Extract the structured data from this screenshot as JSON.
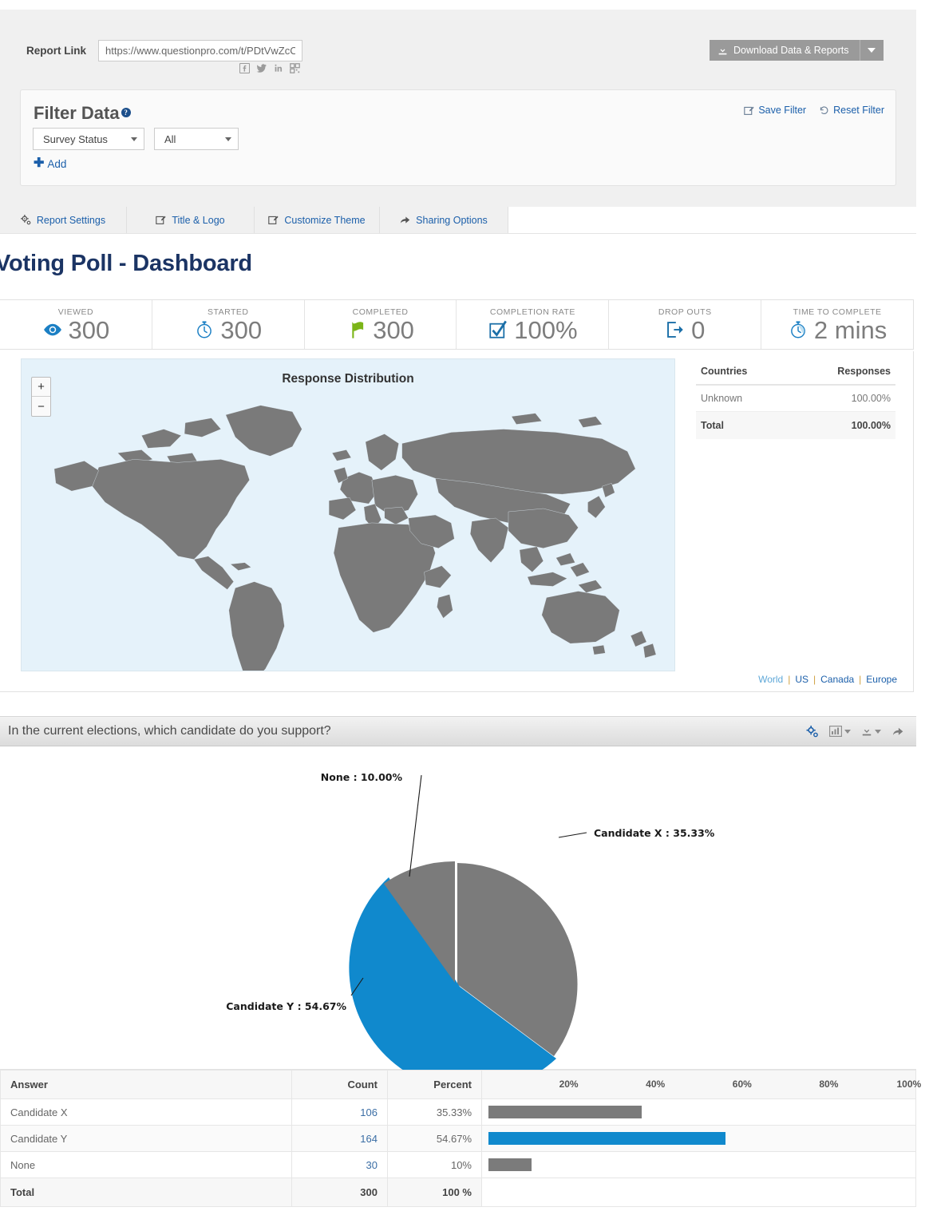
{
  "topbar": {
    "report_link_label": "Report Link",
    "report_link_value": "https://www.questionpro.com/t/PDtVwZcC",
    "download_button": "Download Data & Reports",
    "social": [
      {
        "name": "facebook-icon"
      },
      {
        "name": "twitter-icon"
      },
      {
        "name": "linkedin-icon"
      },
      {
        "name": "qr-code-icon"
      }
    ]
  },
  "filter": {
    "title": "Filter Data",
    "help_char": "?",
    "field_select": "Survey Status",
    "value_select": "All",
    "add_label": "Add",
    "save_label": "Save Filter",
    "reset_label": "Reset Filter"
  },
  "tabs": [
    {
      "label": "Report Settings",
      "icon": "gears-icon"
    },
    {
      "label": "Title & Logo",
      "icon": "edit-icon"
    },
    {
      "label": "Customize Theme",
      "icon": "edit-icon"
    },
    {
      "label": "Sharing Options",
      "icon": "share-icon"
    }
  ],
  "page_title": "Voting Poll - Dashboard",
  "stats": [
    {
      "label": "VIEWED",
      "value": "300",
      "icon": "eye-icon",
      "color": "#1b7fc4"
    },
    {
      "label": "STARTED",
      "value": "300",
      "icon": "stopwatch-icon",
      "color": "#1b7fc4"
    },
    {
      "label": "COMPLETED",
      "value": "300",
      "icon": "flag-icon",
      "color": "#7cb518"
    },
    {
      "label": "COMPLETION RATE",
      "value": "100%",
      "icon": "checkbox-icon",
      "color": "#1b6fa8"
    },
    {
      "label": "DROP OUTS",
      "value": "0",
      "icon": "exit-icon",
      "color": "#1b6fa8"
    },
    {
      "label": "TIME TO COMPLETE",
      "value": "2 mins",
      "icon": "stopwatch-icon",
      "color": "#1b7fc4"
    }
  ],
  "map": {
    "title": "Response Distribution",
    "zoom_in": "+",
    "zoom_out": "−",
    "links": [
      "World",
      "US",
      "Canada",
      "Europe"
    ],
    "separator": "|",
    "table": {
      "headers": [
        "Countries",
        "Responses"
      ],
      "rows": [
        [
          "Unknown",
          "100.00%"
        ]
      ],
      "total": [
        "Total",
        "100.00%"
      ]
    }
  },
  "question": {
    "text": "In the current elections, which candidate do you support?",
    "tools": [
      {
        "name": "settings-gear-icon"
      },
      {
        "name": "chart-type-icon"
      },
      {
        "name": "download-icon"
      },
      {
        "name": "share-icon"
      }
    ]
  },
  "chart_data": {
    "type": "pie",
    "title": "In the current elections, which candidate do you support?",
    "categories": [
      "Candidate X",
      "Candidate Y",
      "None"
    ],
    "values": [
      35.33,
      54.67,
      10.0
    ],
    "counts": [
      106,
      164,
      30
    ],
    "labels": [
      "Candidate X : 35.33%",
      "Candidate Y : 54.67%",
      "None : 10.00%"
    ],
    "colors": [
      "#7b7b7b",
      "#1089cd",
      "#7b7b7b"
    ],
    "total_count": 300,
    "legend": "none",
    "secondary": {
      "type": "bar",
      "orientation": "horizontal",
      "categories": [
        "Candidate X",
        "Candidate Y",
        "None"
      ],
      "values": [
        35.33,
        54.67,
        10.0
      ],
      "xlim": [
        0,
        100
      ],
      "xticks": [
        "20%",
        "40%",
        "60%",
        "80%",
        "100%"
      ],
      "colors": [
        "#7b7b7b",
        "#1089cd",
        "#7b7b7b"
      ],
      "grid": false
    }
  },
  "result_table": {
    "headers": {
      "answer": "Answer",
      "count": "Count",
      "percent": "Percent"
    },
    "rows": [
      {
        "answer": "Candidate X",
        "count": "106",
        "percent": "35.33%",
        "bar_pct": 35.33,
        "color": "#7b7b7b"
      },
      {
        "answer": "Candidate Y",
        "count": "164",
        "percent": "54.67%",
        "bar_pct": 54.67,
        "color": "#1089cd"
      },
      {
        "answer": "None",
        "count": "30",
        "percent": "10%",
        "bar_pct": 10.0,
        "color": "#7b7b7b"
      }
    ],
    "total": {
      "answer": "Total",
      "count": "300",
      "percent": "100 %"
    },
    "axis_ticks": [
      "20%",
      "40%",
      "60%",
      "80%",
      "100%"
    ]
  }
}
